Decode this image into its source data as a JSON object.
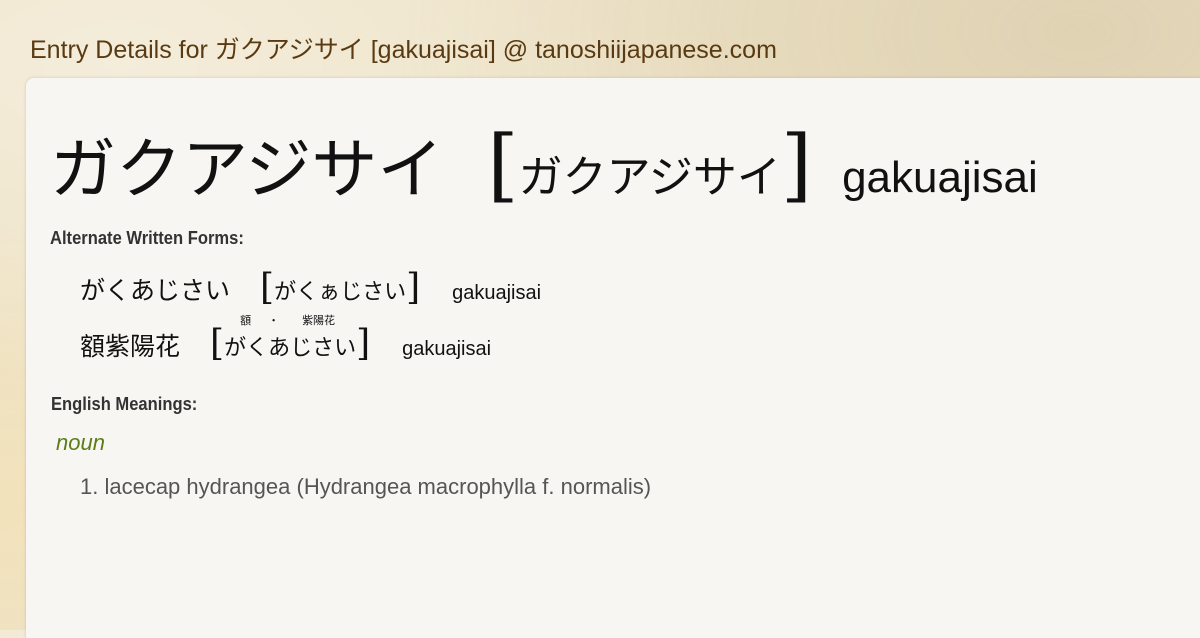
{
  "site_title": "Entry Details for ガクアジサイ [gakuajisai] @ tanoshiijapanese.com",
  "entry": {
    "headword": "ガクアジサイ",
    "bracket_open": "[",
    "reading": "ガクアジサイ",
    "bracket_close": "]",
    "romaji": "gakuajisai"
  },
  "alternate_label": "Alternate Written Forms:",
  "alternates": [
    {
      "word": "がくあじさい",
      "reading": "がくぁじさい",
      "romaji": "gakuajisai",
      "furigana": []
    },
    {
      "word": "額紫陽花",
      "reading": "がくあじさい",
      "romaji": "gakuajisai",
      "furigana": [
        "額",
        "・",
        "紫陽花"
      ]
    }
  ],
  "meanings_label": "English Meanings:",
  "part_of_speech": "noun",
  "meanings": [
    "1. lacecap hydrangea (Hydrangea macrophylla f. normalis)"
  ]
}
